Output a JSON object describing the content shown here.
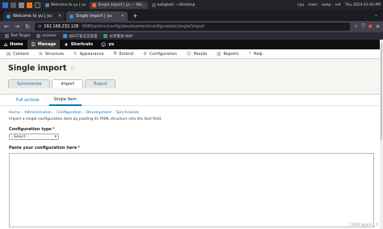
{
  "os_panel": {
    "tasks": [
      {
        "label": "Welcome to yu | yu",
        "color": "#4f7dc8",
        "active": false
      },
      {
        "label": "Single import | yu — Mo...",
        "color": "#e66a2c",
        "active": true
      },
      {
        "label": "kali@kali: ~/Desktop",
        "color": "#555555",
        "active": false
      }
    ],
    "indicators": [
      "cpu",
      "mem",
      "swap",
      "net"
    ],
    "clock": "Thu 2024-01-04 PM"
  },
  "browser": {
    "tabs": [
      {
        "label": "Welcome to yu | yu",
        "active": false
      },
      {
        "label": "Single import | yu",
        "active": true
      }
    ],
    "new_tab": "+",
    "tabs_overflow": "⌄",
    "url_host": "192.168.232.128",
    "url_path": ":8080/admin/config/development/configuration/single/import",
    "bookmarks": [
      {
        "label": "Test Target",
        "color": "#6b6b6b"
      },
      {
        "label": "scanner",
        "color": "#6b6b6b"
      },
      {
        "label": "AJEST安全实验室",
        "color": "#3a8fd6"
      },
      {
        "label": "长亭雷池 WAF",
        "color": "#2c9f6b"
      }
    ]
  },
  "toolbar": {
    "items": [
      {
        "label": "Home",
        "icon": "home-icon",
        "glyph": "⌂",
        "active": false
      },
      {
        "label": "Manage",
        "icon": "menu-icon",
        "glyph": "☰",
        "active": true
      },
      {
        "label": "Shortcuts",
        "icon": "star-icon",
        "glyph": "★",
        "active": false
      },
      {
        "label": "yu",
        "icon": "user-icon",
        "glyph": "☺",
        "active": false
      }
    ]
  },
  "admin_menu": {
    "items": [
      {
        "label": "Content",
        "icon": "content-icon",
        "glyph": "▤"
      },
      {
        "label": "Structure",
        "icon": "structure-icon",
        "glyph": "⊞"
      },
      {
        "label": "Appearance",
        "icon": "appearance-icon",
        "glyph": "✎"
      },
      {
        "label": "Extend",
        "icon": "extend-icon",
        "glyph": "⧉"
      },
      {
        "label": "Configuration",
        "icon": "wrench-icon",
        "glyph": "⚙"
      },
      {
        "label": "People",
        "icon": "people-icon",
        "glyph": "☺"
      },
      {
        "label": "Reports",
        "icon": "reports-icon",
        "glyph": "▥"
      },
      {
        "label": "Help",
        "icon": "help-icon",
        "glyph": "?"
      }
    ]
  },
  "page": {
    "title": "Single import",
    "primary_tabs": [
      {
        "label": "Synchronize",
        "active": false
      },
      {
        "label": "Import",
        "active": true
      },
      {
        "label": "Export",
        "active": false
      }
    ],
    "secondary_tabs": [
      {
        "label": "Full archive",
        "active": false
      },
      {
        "label": "Single item",
        "active": true
      }
    ],
    "breadcrumb": [
      "Home",
      "Administration",
      "Configuration",
      "Development",
      "Synchronize"
    ],
    "description": "Import a single configuration item by pasting its YAML structure into the text field.",
    "config_type_label": "Configuration type",
    "config_type_value": "- Select -",
    "paste_label": "Paste your configuration here",
    "required_mark": "*"
  },
  "watermark": "CSDN @Jack__Y_"
}
